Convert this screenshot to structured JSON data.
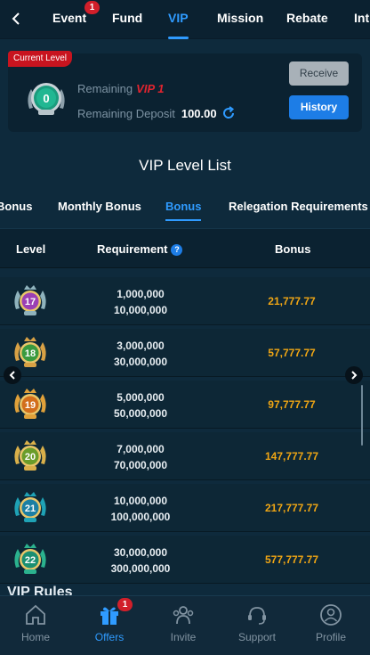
{
  "topnav": {
    "tabs": [
      {
        "label": "Event",
        "badge": "1"
      },
      {
        "label": "Fund"
      },
      {
        "label": "VIP",
        "active": true
      },
      {
        "label": "Mission"
      },
      {
        "label": "Rebate"
      },
      {
        "label": "Int"
      }
    ]
  },
  "current": {
    "tag": "Current Level",
    "level_badge": "0",
    "remaining_label": "Remaining",
    "remaining_target": "VIP 1",
    "deposit_label": "Remaining Deposit",
    "deposit_value": "100.00",
    "receive_label": "Receive",
    "history_label": "History"
  },
  "section_title": "VIP Level List",
  "subtabs": [
    {
      "label": "Bonus"
    },
    {
      "label": "Monthly Bonus"
    },
    {
      "label": "Bonus",
      "active": true
    },
    {
      "label": "Relegation Requirements"
    }
  ],
  "table": {
    "headers": {
      "level": "Level",
      "requirement": "Requirement",
      "help": "?",
      "bonus": "Bonus"
    },
    "rows": [
      {
        "level": "17",
        "req1": "1,000,000",
        "req2": "10,000,000",
        "bonus": "21,777.77"
      },
      {
        "level": "18",
        "req1": "3,000,000",
        "req2": "30,000,000",
        "bonus": "57,777.77"
      },
      {
        "level": "19",
        "req1": "5,000,000",
        "req2": "50,000,000",
        "bonus": "97,777.77"
      },
      {
        "level": "20",
        "req1": "7,000,000",
        "req2": "70,000,000",
        "bonus": "147,777.77"
      },
      {
        "level": "21",
        "req1": "10,000,000",
        "req2": "100,000,000",
        "bonus": "217,777.77"
      },
      {
        "level": "22",
        "req1": "30,000,000",
        "req2": "300,000,000",
        "bonus": "577,777.77"
      }
    ]
  },
  "rules_peek": "VIP Rules",
  "bottomnav": {
    "items": [
      {
        "label": "Home",
        "icon": "home-icon"
      },
      {
        "label": "Offers",
        "icon": "gift-icon",
        "badge": "1",
        "active": true
      },
      {
        "label": "Invite",
        "icon": "invite-icon"
      },
      {
        "label": "Support",
        "icon": "headset-icon"
      },
      {
        "label": "Profile",
        "icon": "profile-icon"
      }
    ]
  },
  "colors": {
    "accent": "#2f9bff",
    "bonus": "#f0a614",
    "alert": "#d11f2a"
  }
}
